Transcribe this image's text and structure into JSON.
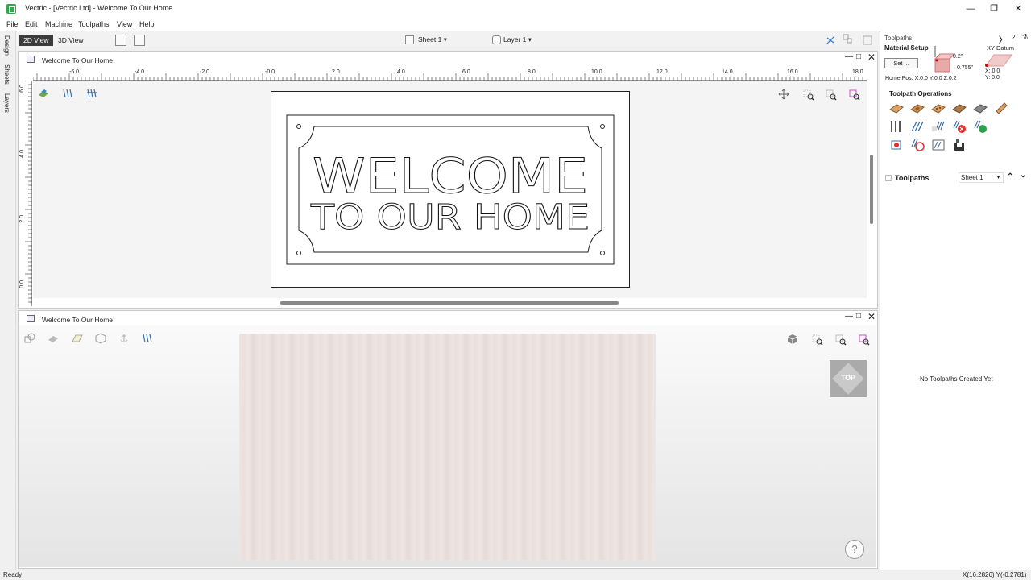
{
  "app": {
    "title": "Vectric - [Vectric Ltd] - Welcome To Our Home"
  },
  "window_controls": {
    "minimize": "—",
    "restore": "❐",
    "close": "✕"
  },
  "menu": [
    "File",
    "Edit",
    "Machine",
    "Toolpaths",
    "View",
    "Help"
  ],
  "toolbar": {
    "view_2d": "2D View",
    "view_3d": "3D View",
    "sheet": "Sheet 1 ▾",
    "layer": "Layer 1 ▾"
  },
  "left_tabs": [
    "Design",
    "Sheets",
    "Layers"
  ],
  "view2d": {
    "title": "Welcome To Our Home",
    "ruler_x_labels": [
      "-6.0",
      "-4.0",
      "-2.0",
      "-0.0",
      "2.0",
      "4.0",
      "6.0",
      "8.0",
      "10.0",
      "12.0",
      "14.0",
      "16.0",
      "18.0"
    ],
    "ruler_y_labels": [
      "6.0",
      "4.0",
      "2.0",
      "0.0"
    ],
    "sign_line1": "WELCOME",
    "sign_line2": "TO OUR HOME"
  },
  "view3d": {
    "title": "Welcome To Our Home",
    "cube_label": "TOP",
    "help": "?"
  },
  "panel": {
    "title": "Toolpaths",
    "material_setup": "Material Setup",
    "set_button": "Set ...",
    "depth1": "0.2\"",
    "depth2": "0.755\"",
    "xy_datum": "XY Datum",
    "xy_x": "X: 0.0",
    "xy_y": "Y: 0.0",
    "home_pos": "Home Pos:  X:0.0 Y:0.0 Z:0.2",
    "operations_title": "Toolpath Operations",
    "toolpaths_label": "Toolpaths",
    "sheet_select": "Sheet 1",
    "empty_message": "No Toolpaths Created Yet",
    "icons": [
      "profile-toolpath-icon",
      "pocket-toolpath-icon",
      "drilling-toolpath-icon",
      "vcarve-toolpath-icon",
      "texture-toolpath-icon",
      "chamfer-toolpath-icon"
    ]
  },
  "status": {
    "left": "Ready",
    "right": "X(16.2826) Y(-0.2781)"
  },
  "colors": {
    "accent": "#2ea84a",
    "dark_button": "#3b3b3b",
    "wood": "#ebe1de"
  }
}
